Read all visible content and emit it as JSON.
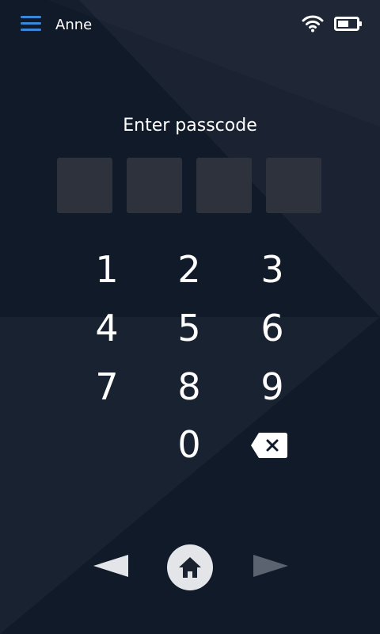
{
  "header": {
    "user_name": "Anne",
    "menu_icon": "hamburger-menu-icon",
    "wifi_icon": "wifi-icon",
    "battery_icon": "battery-icon",
    "accent_color": "#3a86d9"
  },
  "passcode": {
    "prompt": "Enter passcode",
    "length": 4,
    "entered": 0
  },
  "keypad": {
    "keys": [
      "1",
      "2",
      "3",
      "4",
      "5",
      "6",
      "7",
      "8",
      "9",
      "0"
    ],
    "backspace_icon": "backspace-icon"
  },
  "nav": {
    "back_icon": "back-arrow-icon",
    "home_icon": "home-icon",
    "forward_icon": "forward-arrow-icon"
  },
  "colors": {
    "background": "#111a29",
    "slot": "#2d323d",
    "text": "#ffffff"
  }
}
